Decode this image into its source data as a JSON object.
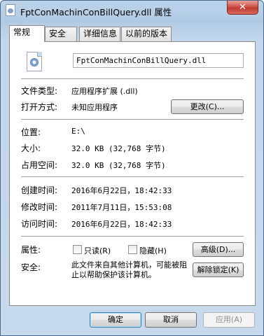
{
  "window": {
    "title": "FptConMachinConBillQuery.dll 属性",
    "close_glyph": "✕"
  },
  "tabs": [
    {
      "label": "常规",
      "active": true
    },
    {
      "label": "安全",
      "active": false
    },
    {
      "label": "详细信息",
      "active": false
    },
    {
      "label": "以前的版本",
      "active": false
    }
  ],
  "general": {
    "file_name": "FptConMachinConBillQuery.dll",
    "file_type_label": "文件类型:",
    "file_type_value": "应用程序扩展 (.dll)",
    "opens_with_label": "打开方式:",
    "opens_with_value": "未知应用程序",
    "change_button": "更改(C)...",
    "location_label": "位置:",
    "location_value": "E:\\",
    "size_label": "大小:",
    "size_value": "32.0 KB (32,768 字节)",
    "size_on_disk_label": "占用空间:",
    "size_on_disk_value": "32.0 KB (32,768 字节)",
    "created_label": "创建时间:",
    "created_value": "2016年6月22日，18:42:33",
    "modified_label": "修改时间:",
    "modified_value": "2011年7月11日，15:53:08",
    "accessed_label": "访问时间:",
    "accessed_value": "2016年6月22日，18:42:33",
    "attributes_label": "属性:",
    "readonly_label": "只读(R)",
    "hidden_label": "隐藏(H)",
    "advanced_button": "高级(D)...",
    "security_label": "安全:",
    "security_text": "此文件来自其他计算机，可能被阻止以帮助保护该计算机。",
    "unblock_button": "解除锁定(K)"
  },
  "footer": {
    "ok": "确定",
    "cancel": "取消",
    "apply": "应用(A)"
  }
}
